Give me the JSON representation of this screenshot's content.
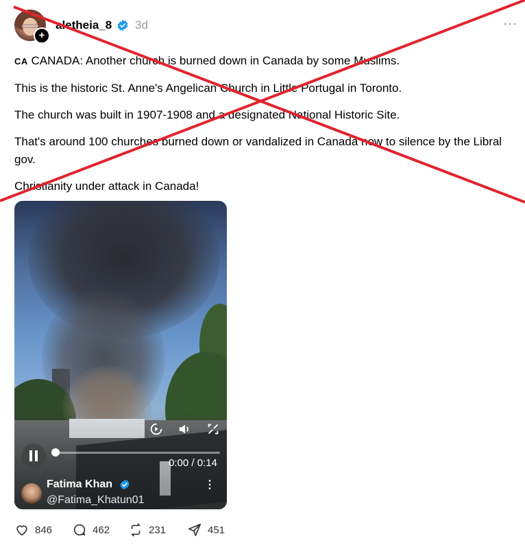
{
  "post": {
    "username": "aletheia_8",
    "time": "3d",
    "more_label": "···",
    "paragraphs": {
      "p1_flag": "CA",
      "p1": "CANADA: Another church is burned down in Canada by some Muslims.",
      "p2": "This is the historic St. Anne's Angelican Church in Little Portugal in Toronto.",
      "p3": "The church was built in 1907-1908 and a designated National Historic Site.",
      "p4": "That's around 100 churches burned down or vandalized in Canada now to silence by the Libral gov.",
      "p5": "Christianity under attack in Canada!"
    }
  },
  "video": {
    "timecode": "0:00 / 0:14",
    "progress_fraction": 0.02,
    "author_name": "Fatima Khan",
    "author_handle": "@Fatima_Khatun01",
    "menu_label": "⋮"
  },
  "actions": {
    "likes": "846",
    "replies": "462",
    "reposts": "231",
    "shares": "451"
  },
  "colors": {
    "verified": "#1d9bf0",
    "cross": "#e0242e",
    "muted": "#999999"
  }
}
